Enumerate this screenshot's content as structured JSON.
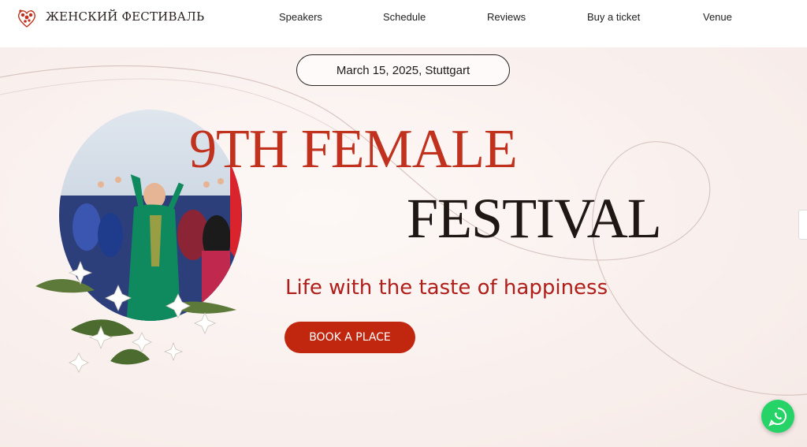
{
  "header": {
    "brand": "ЖЕНСКИЙ ФЕСТИВАЛЬ",
    "nav": [
      {
        "label": "Speakers"
      },
      {
        "label": "Schedule"
      },
      {
        "label": "Reviews"
      },
      {
        "label": "Buy a ticket"
      },
      {
        "label": "Venue"
      }
    ]
  },
  "hero": {
    "date": "March 15, 2025, Stuttgart",
    "title_line1": "9TH FEMALE",
    "title_line2": "FESTIVAL",
    "tagline": "Life with the taste of happiness",
    "cta_label": "BOOK A PLACE"
  },
  "icons": {
    "logo": "heart-flowers-icon",
    "chat": "whatsapp-icon"
  },
  "colors": {
    "accent": "#c1260f",
    "title_red": "#c0321d",
    "tagline_red": "#b01e1a",
    "whatsapp": "#25d366"
  }
}
